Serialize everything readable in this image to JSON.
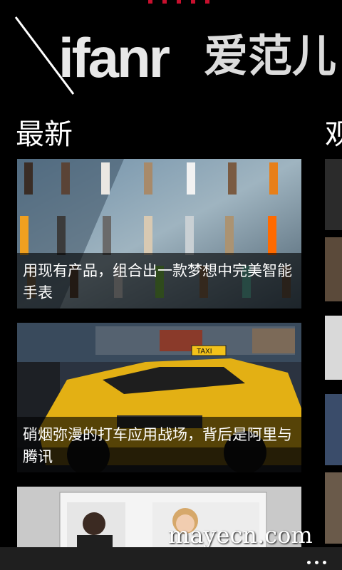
{
  "app": {
    "brand_name": "ifanr",
    "brand_name_cn": "爱范儿"
  },
  "pivot": {
    "current": "最新",
    "next_partial": "观"
  },
  "articles": [
    {
      "title": "用现有产品，组合出一款梦想中完美智能手表",
      "image": "watch-bands-display"
    },
    {
      "title": "硝烟弥漫的打车应用战场，背后是阿里与腾讯",
      "image": "yellow-race-taxi"
    },
    {
      "title": "",
      "image": "video-call-laptop"
    }
  ],
  "app_bar": {
    "more_icon": "more-ellipsis-icon"
  },
  "watermark": "mayecn.com",
  "colors": {
    "accent": "#c8102e",
    "background": "#000000",
    "caption_overlay": "#000000"
  }
}
